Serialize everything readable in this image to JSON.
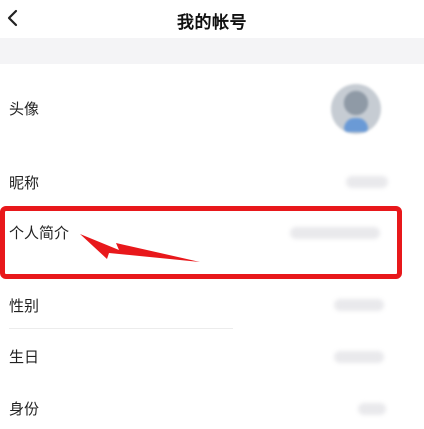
{
  "header": {
    "title": "我的帐号",
    "back_icon": "chevron-left-icon"
  },
  "rows": [
    {
      "label": "头像"
    },
    {
      "label": "昵称"
    },
    {
      "label": "个人简介"
    },
    {
      "label": "性别"
    },
    {
      "label": "生日"
    },
    {
      "label": "身份"
    }
  ],
  "annotation": {
    "color": "#e8181b",
    "arrow_icon": "arrow-pointer-icon"
  }
}
